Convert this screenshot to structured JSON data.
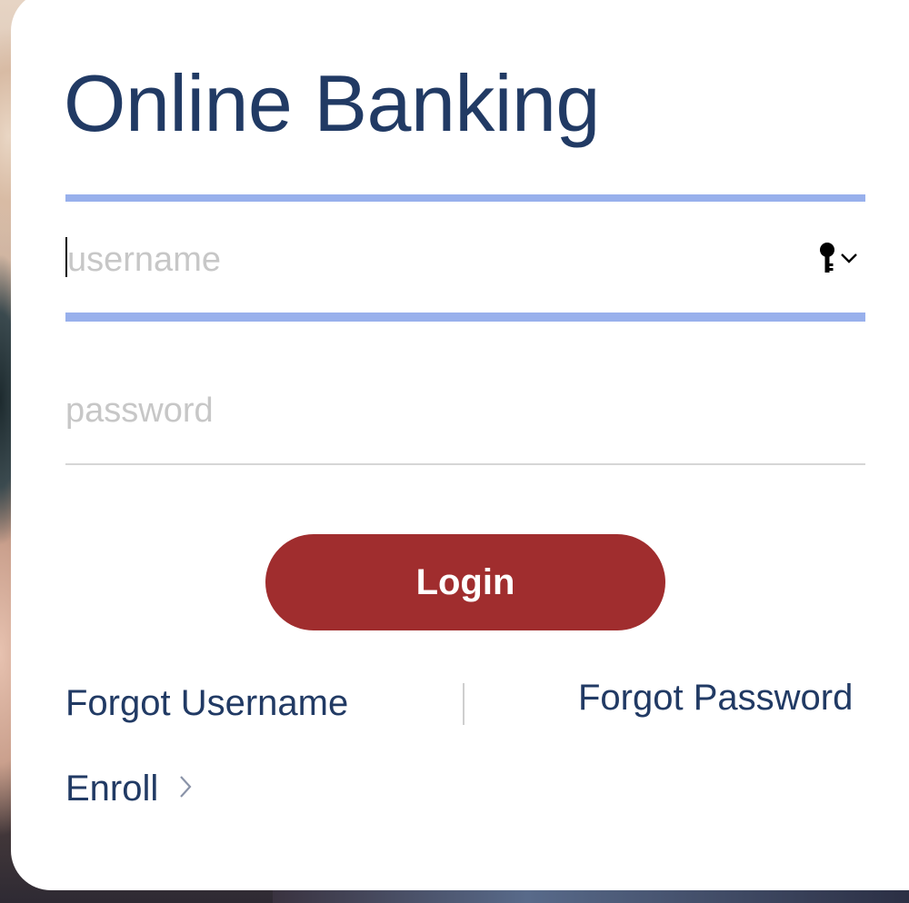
{
  "login_panel": {
    "title": "Online Banking",
    "username": {
      "value": "",
      "placeholder": "username",
      "key_icon": "key-icon",
      "menu_icon": "chevron-down-icon"
    },
    "password": {
      "value": "",
      "placeholder": "password"
    },
    "login_button_label": "Login",
    "links": {
      "forgot_username": "Forgot Username",
      "forgot_password": "Forgot Password",
      "enroll": "Enroll",
      "enroll_icon": "chevron-right-icon"
    }
  },
  "colors": {
    "title": "#213a64",
    "accent_rule": "#98b0ec",
    "login_button": "#a02d2e",
    "placeholder": "#c7c7c7",
    "divider": "#d6d6d6"
  }
}
